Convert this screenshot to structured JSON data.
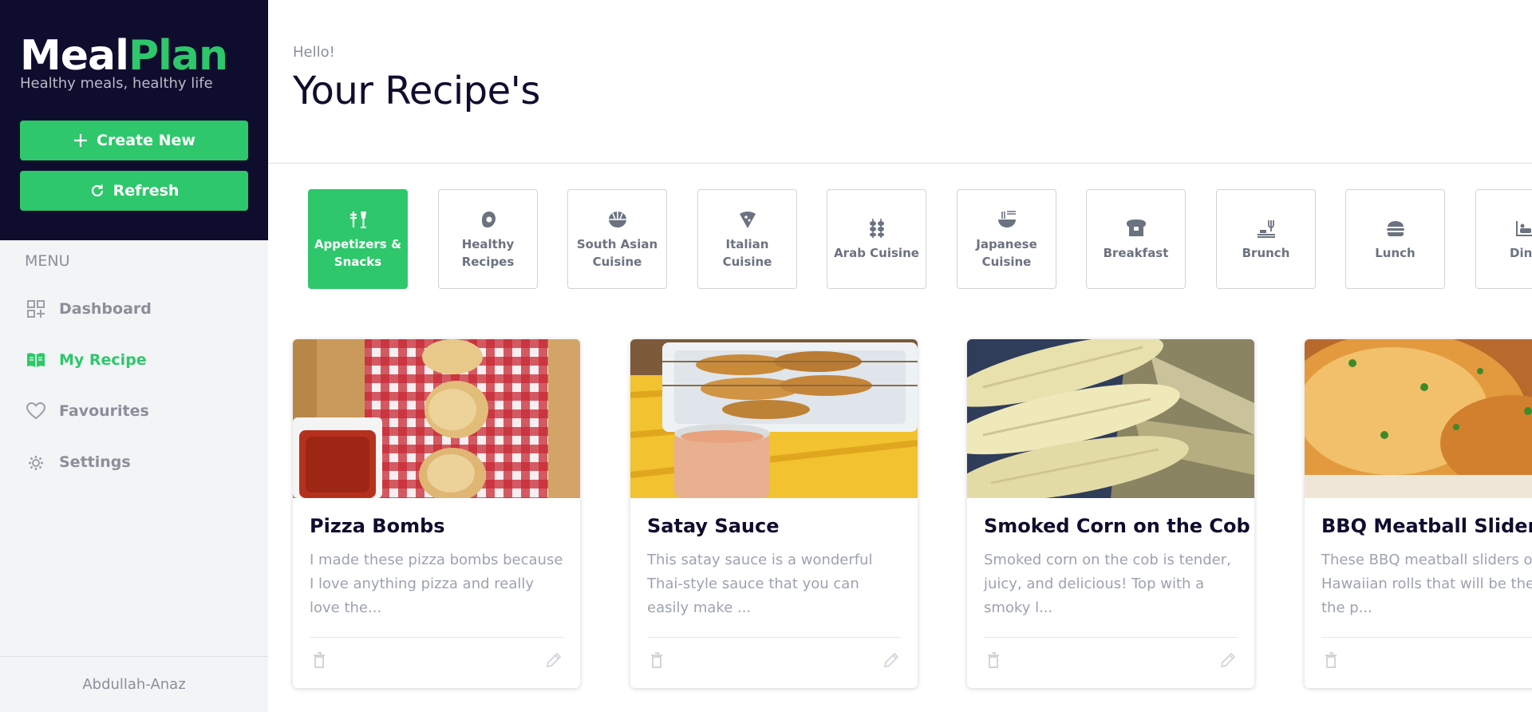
{
  "brand": {
    "logo_part1": "Meal",
    "logo_part2": "Plan",
    "tagline": "Healthy meals, healthy life"
  },
  "sidebar": {
    "create_label": "Create New",
    "refresh_label": "Refresh",
    "menu_heading": "MENU",
    "items": [
      {
        "label": "Dashboard",
        "icon": "dashboard-icon",
        "active": false
      },
      {
        "label": "My Recipe",
        "icon": "book-icon",
        "active": true
      },
      {
        "label": "Favourites",
        "icon": "heart-icon",
        "active": false
      },
      {
        "label": "Settings",
        "icon": "gear-icon",
        "active": false
      }
    ],
    "user": "Abdullah-Anaz"
  },
  "header": {
    "greeting": "Hello!",
    "title": "Your Recipe's"
  },
  "categories": [
    {
      "label": "Appetizers & Snacks",
      "icon": "appetizer-icon",
      "active": true
    },
    {
      "label": "Healthy Recipes",
      "icon": "egg-icon",
      "active": false
    },
    {
      "label": "South Asian Cuisine",
      "icon": "bowl-icon",
      "active": false
    },
    {
      "label": "Italian Cuisine",
      "icon": "pizza-icon",
      "active": false
    },
    {
      "label": "Arab Cuisine",
      "icon": "kebab-icon",
      "active": false
    },
    {
      "label": "Japanese Cuisine",
      "icon": "noodles-icon",
      "active": false
    },
    {
      "label": "Breakfast",
      "icon": "toast-icon",
      "active": false
    },
    {
      "label": "Brunch",
      "icon": "brunch-icon",
      "active": false
    },
    {
      "label": "Lunch",
      "icon": "burger-icon",
      "active": false
    },
    {
      "label": "Dinn",
      "icon": "dinner-icon",
      "active": false
    }
  ],
  "recipes": [
    {
      "title": "Pizza Bombs",
      "description": "I made these pizza bombs because I love anything pizza and really love the..."
    },
    {
      "title": "Satay Sauce",
      "description": "This satay sauce is a wonderful Thai-style sauce that you can easily make ..."
    },
    {
      "title": "Smoked Corn on the Cob",
      "description": "Smoked corn on the cob is tender, juicy, and delicious! Top with a smoky l..."
    },
    {
      "title": "BBQ Meatball Sliders",
      "description": "These BBQ meatball sliders on Hawaiian rolls that will be the hit the p..."
    }
  ],
  "colors": {
    "accent": "#2ec76b",
    "navy": "#0f0d2e",
    "muted": "#8a8f99"
  }
}
